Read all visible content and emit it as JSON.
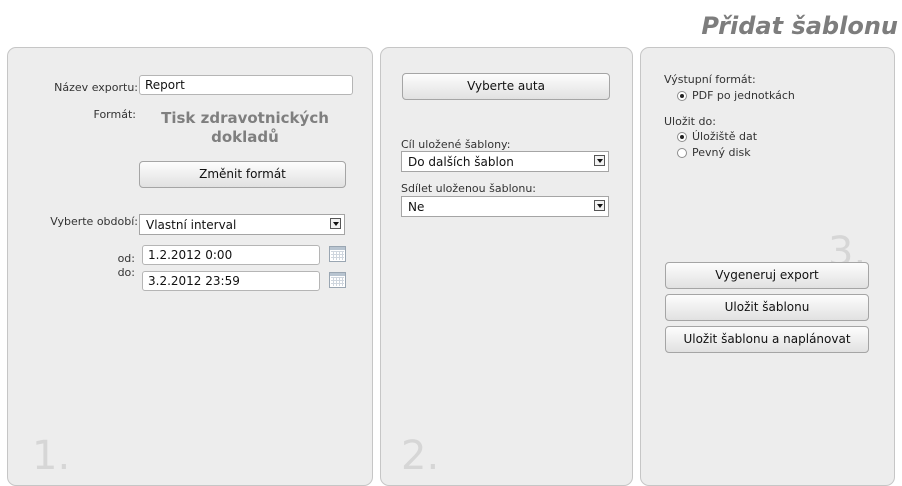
{
  "page_title": "Přidat šablonu",
  "panel1": {
    "step": "1.",
    "export_name_label": "Název exportu:",
    "export_name_value": "Report",
    "format_label": "Formát:",
    "format_value": "Tisk zdravotnických dokladů",
    "change_format_button": "Změnit formát",
    "period_label": "Vyberte období:",
    "period_value": "Vlastní interval",
    "from_label": "od:",
    "from_value": "1.2.2012 0:00",
    "to_label": "do:",
    "to_value": "3.2.2012 23:59"
  },
  "panel2": {
    "step": "2.",
    "select_cars_button": "Vyberte auta",
    "target_label": "Cíl uložené šablony:",
    "target_value": "Do dalších šablon",
    "share_label": "Sdílet uloženou šablonu:",
    "share_value": "Ne"
  },
  "panel3": {
    "step": "3.",
    "output_format_label": "Výstupní formát:",
    "output_formats": [
      {
        "label": "PDF po jednotkách",
        "checked": true
      }
    ],
    "save_to_label": "Uložit do:",
    "save_to_options": [
      {
        "label": "Úložiště dat",
        "checked": true
      },
      {
        "label": "Pevný disk",
        "checked": false
      }
    ],
    "generate_button": "Vygeneruj export",
    "save_button": "Uložit šablonu",
    "save_schedule_button": "Uložit šablonu a naplánovat"
  }
}
